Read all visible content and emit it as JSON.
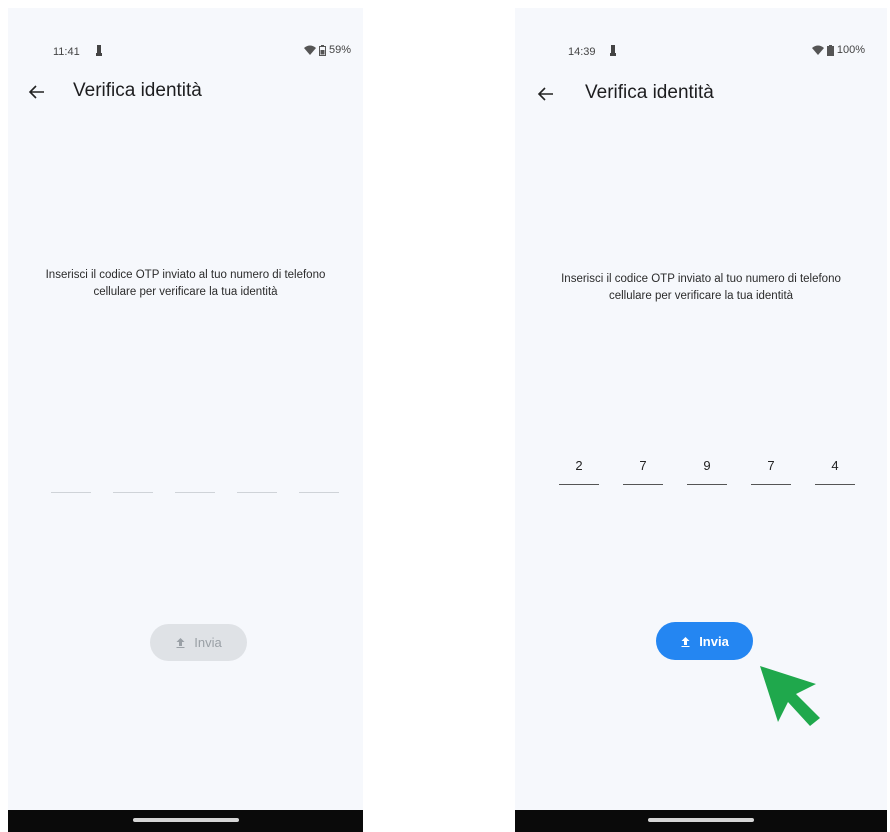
{
  "screens": [
    {
      "status": {
        "time": "11:41",
        "battery": "59%"
      },
      "appbar": {
        "title": "Verifica identità"
      },
      "instruction": "Inserisci il codice OTP inviato al tuo numero di telefono cellulare per verificare la tua identità",
      "otp_digits": [
        "",
        "",
        "",
        "",
        ""
      ],
      "submit": {
        "label": "Invia",
        "state": "disabled"
      }
    },
    {
      "status": {
        "time": "14:39",
        "battery": "100%"
      },
      "appbar": {
        "title": "Verifica identità"
      },
      "instruction": "Inserisci il codice OTP inviato al tuo numero di telefono cellulare per verificare la tua identità",
      "otp_digits": [
        "2",
        "7",
        "9",
        "7",
        "4"
      ],
      "submit": {
        "label": "Invia",
        "state": "enabled"
      }
    }
  ],
  "colors": {
    "screen_bg": "#f6f8fc",
    "button_enabled": "#2486f2",
    "button_disabled": "#dfe2e6",
    "pointer": "#1fa84c"
  },
  "icons": {
    "back": "arrow-left-icon",
    "submit": "upload-icon",
    "wifi": "wifi-icon",
    "battery": "battery-icon",
    "notification": "notification-icon",
    "pointer": "cursor-arrow-icon"
  }
}
